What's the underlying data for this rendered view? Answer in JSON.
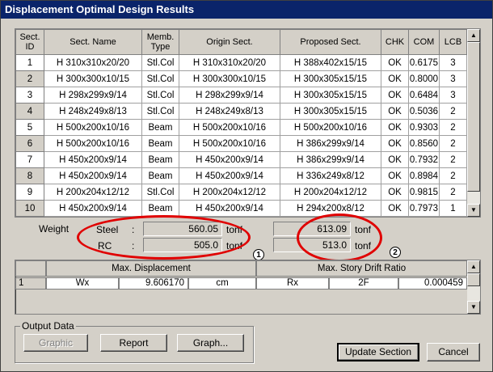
{
  "window": {
    "title": "Displacement Optimal Design Results"
  },
  "table": {
    "headers": [
      "Sect. ID",
      "Sect. Name",
      "Memb. Type",
      "Origin Sect.",
      "Proposed Sect.",
      "CHK",
      "COM",
      "LCB"
    ],
    "rows": [
      [
        "1",
        "H 310x310x20/20",
        "Stl.Col",
        "H 310x310x20/20",
        "H 388x402x15/15",
        "OK",
        "0.6175",
        "3"
      ],
      [
        "2",
        "H 300x300x10/15",
        "Stl.Col",
        "H 300x300x10/15",
        "H 300x305x15/15",
        "OK",
        "0.8000",
        "3"
      ],
      [
        "3",
        "H 298x299x9/14",
        "Stl.Col",
        "H 298x299x9/14",
        "H 300x305x15/15",
        "OK",
        "0.6484",
        "3"
      ],
      [
        "4",
        "H 248x249x8/13",
        "Stl.Col",
        "H 248x249x8/13",
        "H 300x305x15/15",
        "OK",
        "0.5036",
        "2"
      ],
      [
        "5",
        "H 500x200x10/16",
        "Beam",
        "H 500x200x10/16",
        "H 500x200x10/16",
        "OK",
        "0.9303",
        "2"
      ],
      [
        "6",
        "H 500x200x10/16",
        "Beam",
        "H 500x200x10/16",
        "H 386x299x9/14",
        "OK",
        "0.8560",
        "2"
      ],
      [
        "7",
        "H 450x200x9/14",
        "Beam",
        "H 450x200x9/14",
        "H 386x299x9/14",
        "OK",
        "0.7932",
        "2"
      ],
      [
        "8",
        "H 450x200x9/14",
        "Beam",
        "H 450x200x9/14",
        "H 336x249x8/12",
        "OK",
        "0.8984",
        "2"
      ],
      [
        "9",
        "H 200x204x12/12",
        "Stl.Col",
        "H 200x204x12/12",
        "H 200x204x12/12",
        "OK",
        "0.9815",
        "2"
      ],
      [
        "10",
        "H 450x200x9/14",
        "Beam",
        "H 450x200x9/14",
        "H 294x200x8/12",
        "OK",
        "0.7973",
        "1"
      ]
    ]
  },
  "weight": {
    "label": "Weight",
    "steel_label": "Steel",
    "rc_label": "RC",
    "colon": ":",
    "unit": "tonf",
    "steel_origin": "560.05",
    "rc_origin": "505.0",
    "steel_proposed": "613.09",
    "rc_proposed": "513.0"
  },
  "callouts": {
    "one": "1",
    "two": "2"
  },
  "drift_table": {
    "max_disp_header": "Max. Displacement",
    "max_drift_header": "Max. Story Drift Ratio",
    "row": {
      "index": "1",
      "dir": "Wx",
      "disp": "9.606170",
      "unit": "cm",
      "dir2": "Rx",
      "story": "2F",
      "ratio": "0.000459"
    }
  },
  "output": {
    "group_label": "Output Data",
    "graphic_button": "Graphic",
    "report_button": "Report",
    "graph_button": "Graph...",
    "update_button": "Update Section",
    "cancel_button": "Cancel"
  },
  "colors": {
    "title_bg": "#0a246a",
    "highlight": "#e00000",
    "face": "#d4d0c8"
  },
  "icons": {
    "scroll_up": "triangle-up",
    "scroll_down": "triangle-down"
  }
}
